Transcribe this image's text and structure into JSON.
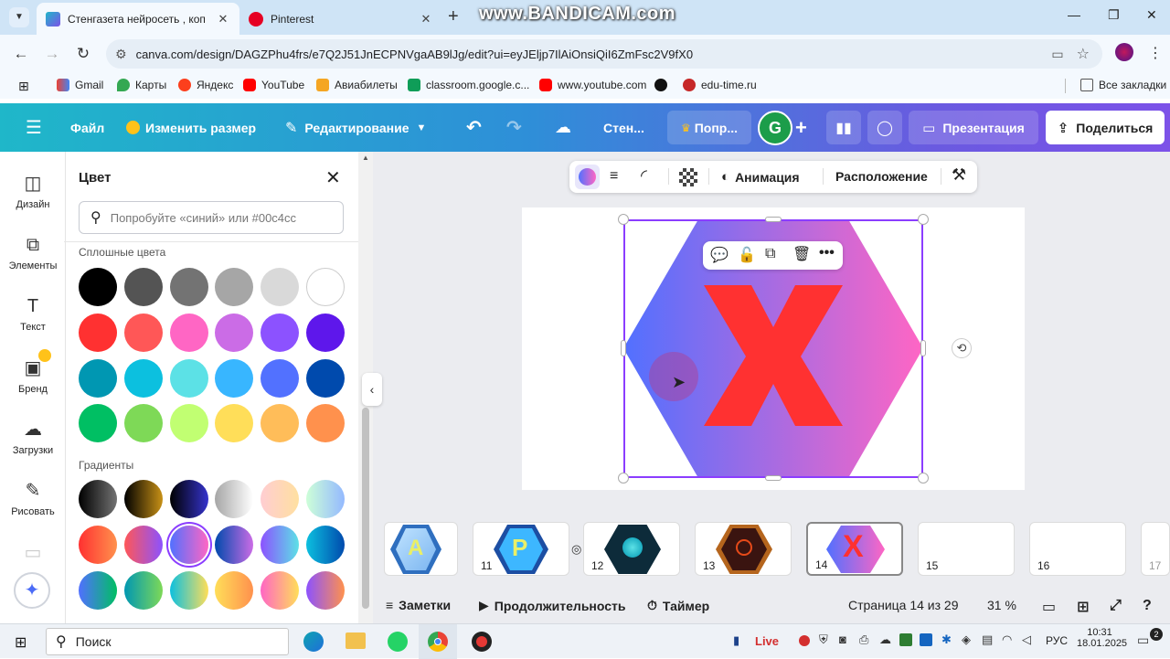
{
  "browser": {
    "tabs": [
      {
        "label": "Стенгазета нейросеть , копия",
        "active": true
      },
      {
        "label": "Pinterest",
        "active": false
      }
    ],
    "watermark": "www.BANDICAM.com",
    "url": "canva.com/design/DAGZPhu4frs/e7Q2J51JnECPNVgaAB9lJg/edit?ui=eyJEljp7IlAiOnsiQiI6ZmFsc2V9fX0",
    "bookmarks": [
      "Gmail",
      "Карты",
      "Яндекс",
      "YouTube",
      "Авиабилеты",
      "classroom.google.c...",
      "www.youtube.com",
      "edu-time.ru"
    ],
    "all_bookmarks": "Все закладки"
  },
  "header": {
    "menu_icon": "hamburger-icon",
    "file": "Файл",
    "resize": "Изменить размер",
    "editing": "Редактирование",
    "doc_title": "Стен...",
    "try_pro": "Попр...",
    "avatar_letter": "G",
    "present": "Презентация",
    "share": "Поделиться"
  },
  "rail": {
    "items": [
      {
        "label": "Дизайн",
        "icon": "design-icon"
      },
      {
        "label": "Элементы",
        "icon": "elements-icon"
      },
      {
        "label": "Текст",
        "icon": "text-icon"
      },
      {
        "label": "Бренд",
        "icon": "brand-icon"
      },
      {
        "label": "Загрузки",
        "icon": "uploads-icon"
      },
      {
        "label": "Рисовать",
        "icon": "draw-icon"
      }
    ]
  },
  "color_panel": {
    "title": "Цвет",
    "search_placeholder": "Попробуйте «синий» или #00c4cc",
    "solid_title": "Сплошные цвета",
    "gradients_title": "Градиенты",
    "solid_colors": [
      "#000000",
      "#545454",
      "#737373",
      "#a6a6a6",
      "#d9d9d9",
      "#ffffff",
      "#ff3131",
      "#ff5757",
      "#ff66c4",
      "#cb6ce6",
      "#8c52ff",
      "#5e17eb",
      "#0097b2",
      "#0cc0df",
      "#5ce1e6",
      "#38b6ff",
      "#5271ff",
      "#004aad",
      "#00bf63",
      "#7ed957",
      "#c1ff72",
      "#ffde59",
      "#ffbd59",
      "#ff914d"
    ],
    "gradients": [
      [
        "#000000",
        "#737373"
      ],
      [
        "#000000",
        "#c89116"
      ],
      [
        "#000000",
        "#3533cd"
      ],
      [
        "#a6a6a6",
        "#ffffff"
      ],
      [
        "#ffcdd2",
        "#ffe0a0"
      ],
      [
        "#cdffd8",
        "#94b9ff"
      ],
      [
        "#ff3131",
        "#ff914d"
      ],
      [
        "#ff5757",
        "#8c52ff"
      ],
      [
        "#5170ff",
        "#ff66c4"
      ],
      [
        "#004aad",
        "#cb6ce6"
      ],
      [
        "#8c52ff",
        "#5ce1e6"
      ],
      [
        "#0cc0df",
        "#004aad"
      ],
      [
        "#5170ff",
        "#00bf63"
      ],
      [
        "#0097b2",
        "#7ed957"
      ],
      [
        "#0cc0df",
        "#ffde59"
      ],
      [
        "#ffde59",
        "#ff914d"
      ],
      [
        "#ff66c4",
        "#ffde59"
      ],
      [
        "#8c52ff",
        "#ff914d"
      ]
    ]
  },
  "toolbar": {
    "animation": "Анимация",
    "position": "Расположение"
  },
  "thumbnails": [
    {
      "num": ""
    },
    {
      "num": "11"
    },
    {
      "num": "12"
    },
    {
      "num": "13"
    },
    {
      "num": "14"
    },
    {
      "num": "15"
    },
    {
      "num": "16"
    },
    {
      "num": "17"
    }
  ],
  "footer": {
    "notes": "Заметки",
    "duration": "Продолжительность",
    "timer": "Таймер",
    "page_info": "Страница 14 из 29",
    "zoom": "31 %"
  },
  "taskbar": {
    "search": "Поиск",
    "live": "Live",
    "lang": "РУС",
    "time": "10:31",
    "date": "18.01.2025",
    "notif_count": "2"
  }
}
